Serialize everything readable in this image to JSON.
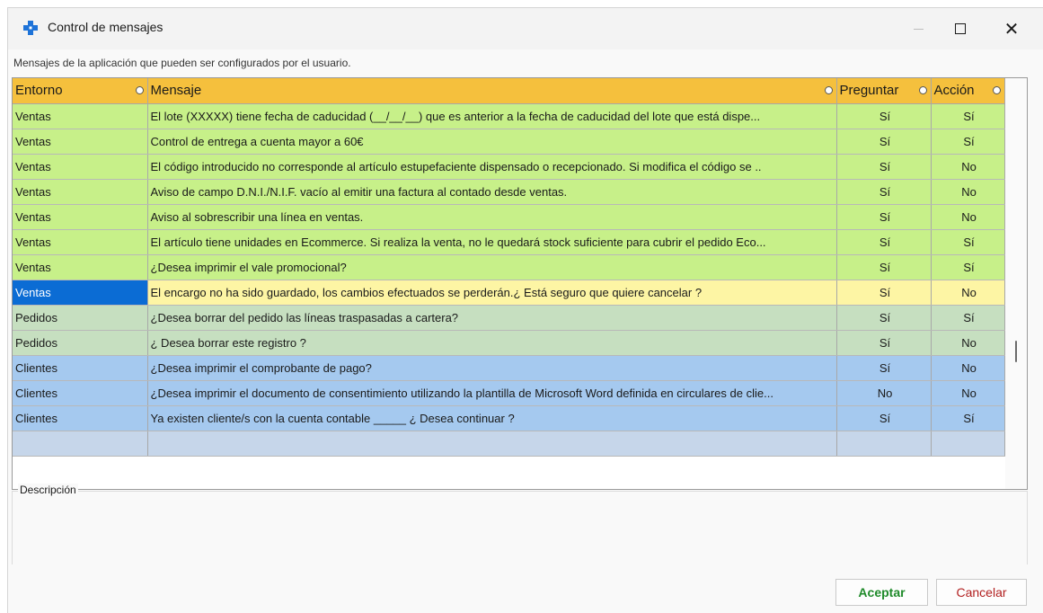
{
  "window": {
    "title": "Control de mensajes",
    "icon": "blue-puzzle-cross-icon"
  },
  "subtitle": "Mensajes de la aplicación que pueden ser configurados por el usuario.",
  "grid": {
    "headers": {
      "entorno": "Entorno",
      "mensaje": "Mensaje",
      "preguntar": "Preguntar",
      "accion": "Acción"
    },
    "rows": [
      {
        "entorno": "Ventas",
        "mensaje": "El lote (XXXXX) tiene fecha de caducidad (__/__/__) que es anterior a la fecha de caducidad del lote que está dispe...",
        "preguntar": "Sí",
        "accion": "Sí"
      },
      {
        "entorno": "Ventas",
        "mensaje": "Control de entrega a cuenta mayor a 60€",
        "preguntar": "Sí",
        "accion": "Sí"
      },
      {
        "entorno": "Ventas",
        "mensaje": "El código introducido no corresponde al artículo estupefaciente dispensado o recepcionado. Si modifica el código se ..",
        "preguntar": "Sí",
        "accion": "No"
      },
      {
        "entorno": "Ventas",
        "mensaje": "Aviso de campo D.N.I./N.I.F. vacío al emitir una factura al contado desde ventas.",
        "preguntar": "Sí",
        "accion": "No"
      },
      {
        "entorno": "Ventas",
        "mensaje": "Aviso al sobrescribir una línea en ventas.",
        "preguntar": "Sí",
        "accion": "No"
      },
      {
        "entorno": "Ventas",
        "mensaje": "El artículo tiene unidades en Ecommerce. Si realiza la venta, no le quedará stock suficiente para cubrir el pedido Eco...",
        "preguntar": "Sí",
        "accion": "Sí"
      },
      {
        "entorno": "Ventas",
        "mensaje": "¿Desea imprimir el vale promocional?",
        "preguntar": "Sí",
        "accion": "Sí"
      },
      {
        "entorno": "Ventas",
        "mensaje": "El encargo no ha sido guardado, los cambios efectuados se perderán.¿ Está seguro que quiere cancelar ?",
        "preguntar": "Sí",
        "accion": "No"
      },
      {
        "entorno": "Pedidos",
        "mensaje": "¿Desea borrar del pedido las líneas traspasadas a cartera?",
        "preguntar": "Sí",
        "accion": "Sí"
      },
      {
        "entorno": "Pedidos",
        "mensaje": "¿ Desea borrar este registro ?",
        "preguntar": "Sí",
        "accion": "No"
      },
      {
        "entorno": "Clientes",
        "mensaje": "¿Desea imprimir el comprobante de pago?",
        "preguntar": "Sí",
        "accion": "No"
      },
      {
        "entorno": "Clientes",
        "mensaje": "¿Desea imprimir el documento de consentimiento utilizando la plantilla de Microsoft Word definida en circulares de clie...",
        "preguntar": "No",
        "accion": "No"
      },
      {
        "entorno": "Clientes",
        "mensaje": "Ya existen cliente/s con la cuenta contable _____ ¿ Desea continuar ?",
        "preguntar": "Sí",
        "accion": "Sí"
      }
    ]
  },
  "description": {
    "label": "Descripción"
  },
  "buttons": {
    "ok": "Aceptar",
    "cancel": "Cancelar"
  },
  "colors": {
    "header": "#f5c03d",
    "ventas": "#c7f089",
    "ventas_current": "#fdf5a4",
    "selected_cell": "#0b6cd4",
    "pedidos": "#c6dfc0",
    "clientes": "#a5c9ef"
  }
}
